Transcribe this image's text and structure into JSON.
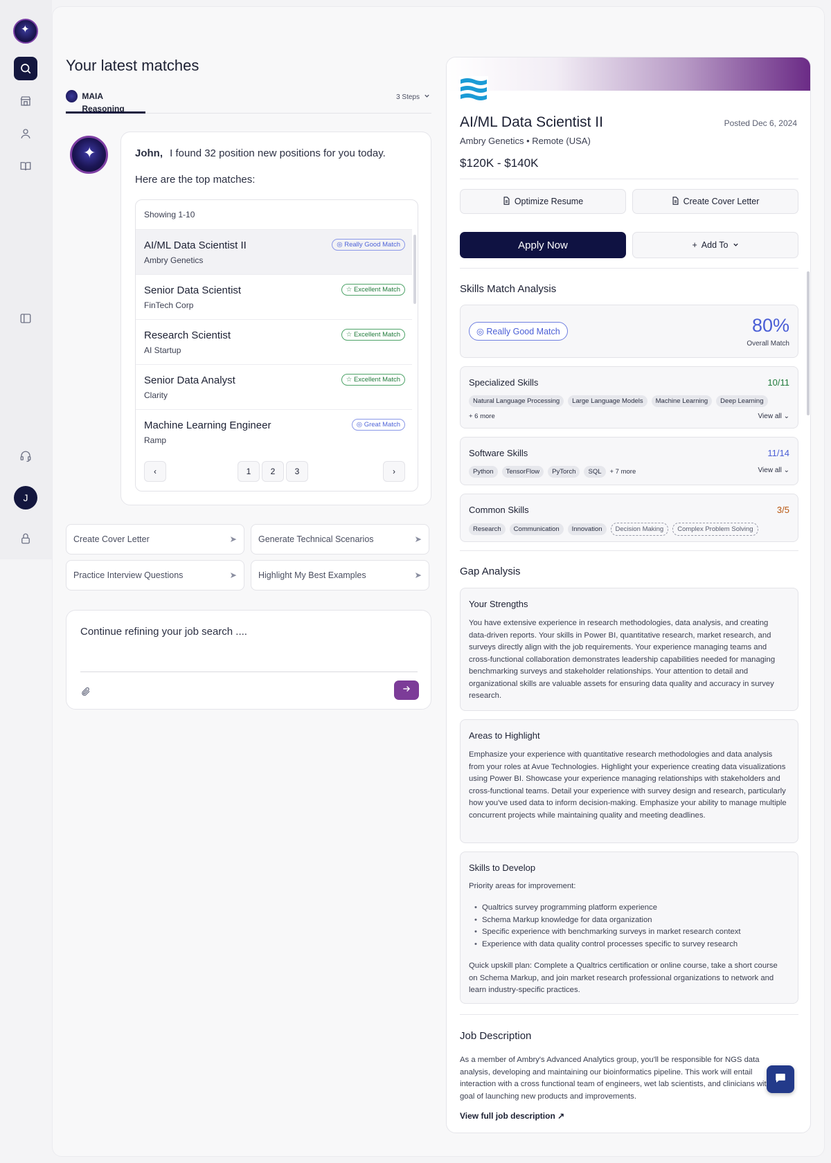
{
  "left": {
    "title": "Your latest matches",
    "tab_label": "MAIA Reasoning",
    "steps_label": "3 Steps",
    "greeting_name": "John,",
    "greeting_text": "I found 32 position new positions for you today.",
    "top_matches_text": "Here are the top matches:",
    "showing_label": "Showing 1-10",
    "matches": [
      {
        "title": "AI/ML Data Scientist II",
        "company": "Ambry Genetics",
        "badge": "Really Good Match"
      },
      {
        "title": "Senior Data Scientist",
        "company": "FinTech Corp",
        "badge": "Excellent Match"
      },
      {
        "title": "Research Scientist",
        "company": "AI Startup",
        "badge": "Excellent Match"
      },
      {
        "title": "Senior Data Analyst",
        "company": "Clarity",
        "badge": "Excellent Match"
      },
      {
        "title": "Machine Learning Engineer",
        "company": "Ramp",
        "badge": "Great Match"
      }
    ],
    "pages": [
      "1",
      "2",
      "3"
    ],
    "suggestions": [
      "Create Cover Letter",
      "Generate Technical Scenarios",
      "Practice Interview Questions",
      "Highlight My Best Examples"
    ],
    "input_text": "Continue refining your job search ...."
  },
  "sidebar": {
    "user_initial": "J"
  },
  "job": {
    "title": "AI/ML Data Scientist II",
    "posted": "Posted Dec 6, 2024",
    "company_location": "Ambry Genetics • Remote (USA)",
    "salary": "$120K - $140K",
    "optimize_label": "Optimize Resume",
    "cover_letter_label": "Create Cover Letter",
    "apply_label": "Apply Now",
    "add_to_label": "Add To"
  },
  "skills": {
    "section_title": "Skills Match Analysis",
    "match_badge": "Really Good Match",
    "percent": "80%",
    "percent_label": "Overall Match",
    "specialized": {
      "title": "Specialized Skills",
      "count": "10/11",
      "chips": [
        "Natural Language Processing",
        "Large Language Models",
        "Machine Learning",
        "Deep Learning"
      ],
      "more": "+ 6 more",
      "view_all": "View all"
    },
    "software": {
      "title": "Software Skills",
      "count": "11/14",
      "chips": [
        "Python",
        "TensorFlow",
        "PyTorch",
        "SQL"
      ],
      "more": "+ 7 more",
      "view_all": "View all"
    },
    "common": {
      "title": "Common Skills",
      "count": "3/5",
      "chips": [
        "Research",
        "Communication",
        "Innovation"
      ],
      "missing_chips": [
        "Decision Making",
        "Complex Problem Solving"
      ]
    }
  },
  "gap": {
    "section_title": "Gap Analysis",
    "strengths_title": "Your Strengths",
    "strengths_text": "You have extensive experience in research methodologies, data analysis, and creating data-driven reports. Your skills in Power BI, quantitative research, market research, and surveys directly align with the job requirements. Your experience managing teams and cross-functional collaboration demonstrates leadership capabilities needed for managing benchmarking surveys and stakeholder relationships. Your attention to detail and organizational skills are valuable assets for ensuring data quality and accuracy in survey research.",
    "highlight_title": "Areas to Highlight",
    "highlight_text": "Emphasize your experience with quantitative research methodologies and data analysis from your roles at Avue Technologies. Highlight your experience creating data visualizations using Power BI. Showcase your experience managing relationships with stakeholders and cross-functional teams. Detail your experience with survey design and research, particularly how you've used data to inform decision-making. Emphasize your ability to manage multiple concurrent projects while maintaining quality and meeting deadlines.",
    "develop_title": "Skills to Develop",
    "develop_intro": "Priority areas for improvement:",
    "develop_items": [
      "Qualtrics survey programming platform experience",
      "Schema Markup knowledge for data organization",
      "Specific experience with benchmarking surveys in market research context",
      "Experience with data quality control processes specific to survey research"
    ],
    "develop_plan": "Quick upskill plan: Complete a Qualtrics certification or online course, take a short course on Schema Markup, and join market research professional organizations to network and learn industry-specific practices."
  },
  "description": {
    "section_title": "Job Description",
    "text": "As a member of Ambry's Advanced Analytics group, you'll be responsible for NGS data analysis, developing and maintaining our bioinformatics pipeline. This work will entail interaction with a cross functional team of engineers, wet lab scientists, and clinicians with the goal of launching new products and improvements.",
    "link": "View full job description"
  },
  "colors": {
    "accent": "#0f1242",
    "purple": "#7c3c98",
    "match_blue": "#4a5ed6",
    "match_green": "#1f7a3a",
    "count_orange": "#b8560f"
  }
}
